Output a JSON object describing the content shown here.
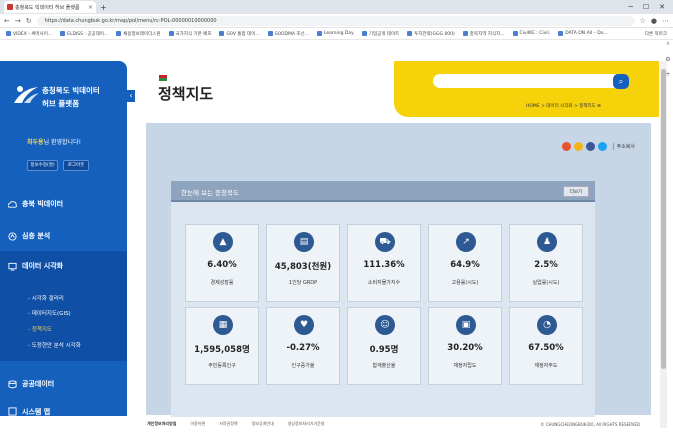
{
  "browser": {
    "tab_title": "충청북도 빅데이터 허브 플랫폼",
    "url": "https://data.chungbuk.go.kr/map/pol/menu/rc-POL-00000010000000",
    "bookmarks": [
      "VIDEX - 써머사이...",
      "ELDISS : 공공데이...",
      "채용정보레이더스원",
      "국가지식 기본 배포",
      "G0V 통합 데이...",
      "G0ODMA 조선...",
      "Learning Day",
      "기업공개 데이트",
      "투자전략(GGG 000)",
      "충북지역 지식지...",
      "CivilKE : Civil.",
      "DATA ON All – Do..."
    ],
    "bookmarks_right": "다른 북마크"
  },
  "sidebar": {
    "logo_line1": "충청북도 빅데이터",
    "logo_line2": "허브 플랫폼",
    "welcome_name": "최두용",
    "welcome_text": "님 환영합니다!",
    "btn_info": "정보수정(명)",
    "btn_logout": "로그아웃",
    "menu": [
      "충북 빅데이터",
      "심층 분석",
      "데이터 시각화",
      "공공데이터",
      "시스템 맵"
    ],
    "submenu": [
      "- 시각화 갤러리",
      "- 데이터지도(GIS)",
      "- 정책지도",
      "- 도정현안 분석 시각화"
    ]
  },
  "header": {
    "title": "정책지도",
    "search_placeholder": "",
    "breadcrumb": "HOME > 데이터 시각화 > 정책지도 ⊕"
  },
  "share": {
    "copy_label": "주소복사"
  },
  "panel": {
    "title": "한눈에 보는 충청북도",
    "more_button": "더보기"
  },
  "cards": [
    {
      "icon": "bar-growth",
      "value": "6.40%",
      "label": "경제성장률"
    },
    {
      "icon": "document",
      "value": "45,803(천원)",
      "label": "1인당 GRDP"
    },
    {
      "icon": "cart",
      "value": "111.36%",
      "label": "소비자물가지수"
    },
    {
      "icon": "chart-up",
      "value": "64.9%",
      "label": "고용률(시도)"
    },
    {
      "icon": "person",
      "value": "2.5%",
      "label": "실업률(시도)"
    },
    {
      "icon": "building",
      "value": "1,595,058명",
      "label": "주민등록인구"
    },
    {
      "icon": "heart",
      "value": "-0.27%",
      "label": "인구증가율"
    },
    {
      "icon": "baby",
      "value": "0.95명",
      "label": "합계출산율"
    },
    {
      "icon": "finance",
      "value": "30.20%",
      "label": "재정자립도"
    },
    {
      "icon": "finance-pie",
      "value": "67.50%",
      "label": "재정자주도"
    }
  ],
  "footer": {
    "links": [
      "개인정보처리방침",
      "이용약관",
      "저작권정책",
      "정보공개안내",
      "영상정보처리기기운영"
    ],
    "copyright": "© CHUNGCHEONGBUK-DO, All RIGHTS RESERVED"
  }
}
